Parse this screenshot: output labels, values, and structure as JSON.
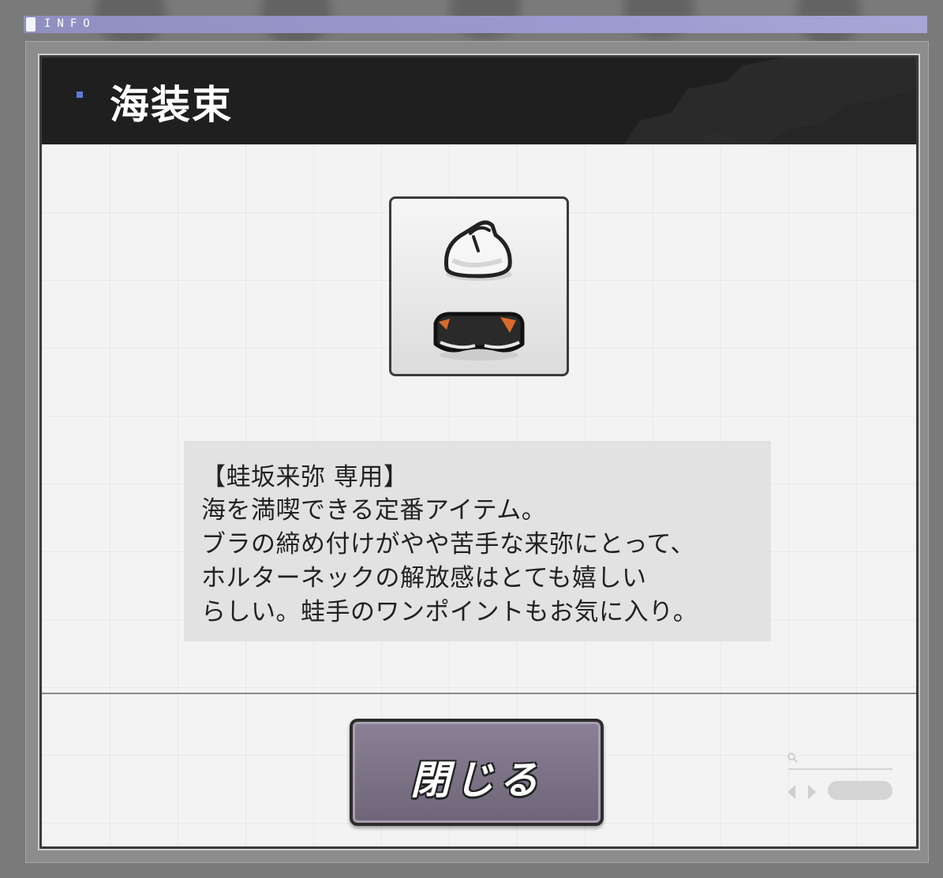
{
  "header": {
    "info_label": "INFO"
  },
  "window": {
    "title": "海装束"
  },
  "item": {
    "icon_name": "swimsuit-icon"
  },
  "description": {
    "lines": [
      "【蛙坂来弥 専用】",
      "海を満喫できる定番アイテム。",
      "ブラの締め付けがやや苦手な来弥にとって、",
      "ホルターネックの解放感はとても嬉しい",
      "らしい。蛙手のワンポイントもお気に入り。"
    ]
  },
  "footer": {
    "close_label": "閉じる"
  },
  "colors": {
    "title_bar": "#1f1f1f",
    "info_bar": "#9a9ad0",
    "accent": "#5d79d9",
    "button": "#7a7186"
  }
}
